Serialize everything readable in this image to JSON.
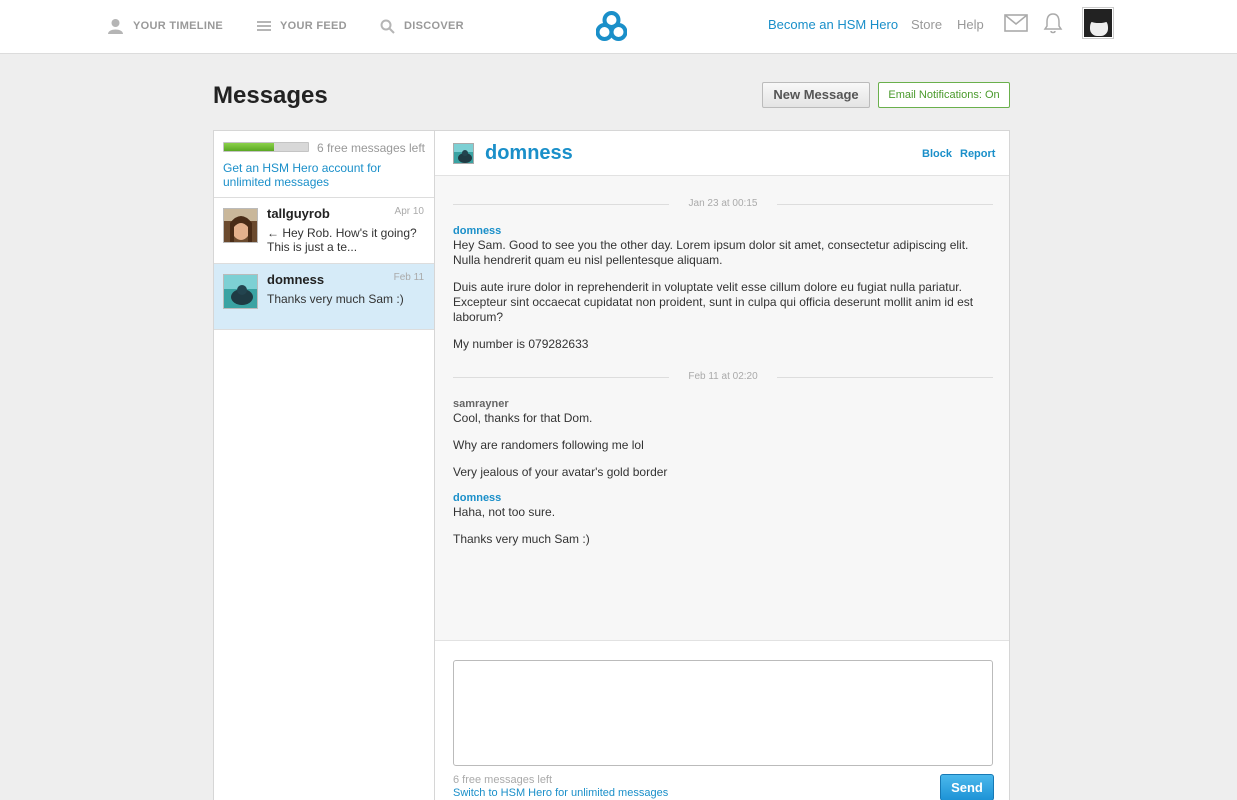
{
  "nav": {
    "timeline": "YOUR TIMELINE",
    "feed": "YOUR FEED",
    "discover": "DISCOVER",
    "hero": "Become an HSM Hero",
    "store": "Store",
    "help": "Help"
  },
  "icons": {
    "timeline": "person-icon",
    "feed": "list-icon",
    "discover": "search-icon",
    "logo": "hsm-logo",
    "mail": "envelope-icon",
    "notifications": "bell-icon"
  },
  "colors": {
    "accent": "#1a8fc9",
    "success": "#4a9a2c",
    "selected": "#d6ebf8"
  },
  "page": {
    "title": "Messages",
    "new_message": "New Message",
    "email_notifications": "Email Notifications: On"
  },
  "sidebar": {
    "quota_text": "6 free messages left",
    "quota_fraction": 0.6,
    "upgrade_link": "Get an HSM Hero account for unlimited messages",
    "conversations": [
      {
        "name": "tallguyrob",
        "date": "Apr 10",
        "snippet": "← Hey Rob. How's it going? This is just a te..."
      },
      {
        "name": "domness",
        "date": "Feb 11",
        "snippet": "Thanks very much Sam :)"
      }
    ]
  },
  "conversation": {
    "name": "domness",
    "block": "Block",
    "report": "Report",
    "groups": [
      {
        "date": "Jan 23 at 00:15",
        "messages": [
          {
            "author": "domness",
            "lines": [
              "Hey Sam. Good to see you the other day. Lorem ipsum dolor sit amet, consectetur adipiscing elit. Nulla hendrerit quam eu nisl pellentesque aliquam.",
              "Duis aute irure dolor in reprehenderit in voluptate velit esse cillum dolore eu fugiat nulla pariatur. Excepteur sint occaecat cupidatat non proident, sunt in culpa qui officia deserunt mollit anim id est laborum?",
              "My number is 079282633"
            ]
          }
        ]
      },
      {
        "date": "Feb 11 at 02:20",
        "messages": [
          {
            "author": "samrayner",
            "lines": [
              "Cool, thanks for that Dom.",
              "Why are randomers following me lol",
              "Very jealous of your avatar's gold border"
            ]
          },
          {
            "author": "domness",
            "lines": [
              "Haha, not too sure.",
              "Thanks very much Sam :)"
            ]
          }
        ]
      }
    ]
  },
  "compose": {
    "placeholder": "",
    "remaining": "6 free messages left",
    "switch_link": "Switch to HSM Hero for unlimited messages",
    "send": "Send"
  }
}
